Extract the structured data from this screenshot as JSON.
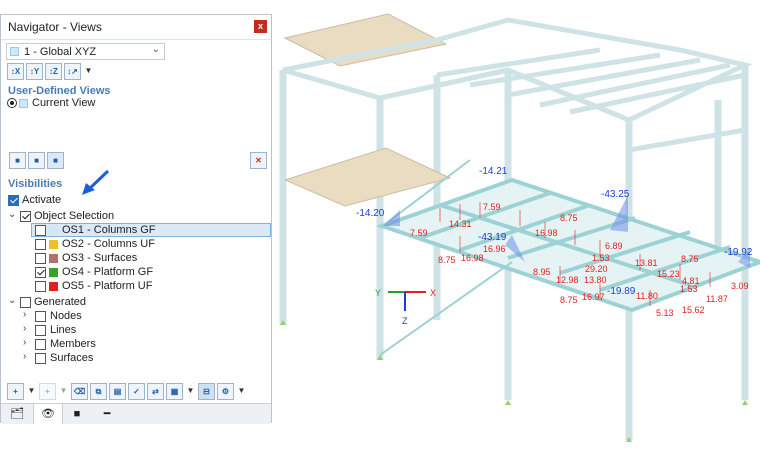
{
  "panel": {
    "title": "Navigator - Views",
    "close_label": "x",
    "view_combo": "1 - Global XYZ",
    "user_defined_header": "User-Defined Views",
    "current_view": "Current View",
    "visibilities_header": "Visibilities",
    "activate": "Activate",
    "object_selection": "Object Selection",
    "object_sets": [
      {
        "label": "OS1 - Columns GF",
        "color": "#cfe7f7",
        "checked": false
      },
      {
        "label": "OS2 - Columns UF",
        "color": "#f0c020",
        "checked": false
      },
      {
        "label": "OS3 - Surfaces",
        "color": "#b07070",
        "checked": false
      },
      {
        "label": "OS4 - Platform GF",
        "color": "#3aa02a",
        "checked": true
      },
      {
        "label": "OS5 - Platform UF",
        "color": "#e02020",
        "checked": false
      }
    ],
    "generated": "Generated",
    "generated_items": [
      "Nodes",
      "Lines",
      "Members",
      "Surfaces"
    ]
  },
  "model": {
    "blue_values": [
      "-14.21",
      "-14.20",
      "-43.25",
      "-43.19",
      "-19.92",
      "-19.89"
    ],
    "red_values": [
      "7.59",
      "8.75",
      "7.59",
      "14.31",
      "16.98",
      "16.96",
      "16.98",
      "8.75",
      "6.89",
      "1.53",
      "13.81",
      "8.75",
      "8.95",
      "29.20",
      "15.23",
      "12.98",
      "13.80",
      "4.81",
      "3.09",
      "8.75",
      "16.97",
      "11.80",
      "11.87",
      "1.53",
      "5.13",
      "15.62"
    ],
    "axes": {
      "x": "X",
      "y": "Y",
      "z": "Z"
    }
  },
  "colors": {
    "accent": "#2a6bbd",
    "structure": "#cfe3e6",
    "slab": "#e9dcc1",
    "result": "#e02020",
    "result_blue": "#1a3fd0"
  }
}
